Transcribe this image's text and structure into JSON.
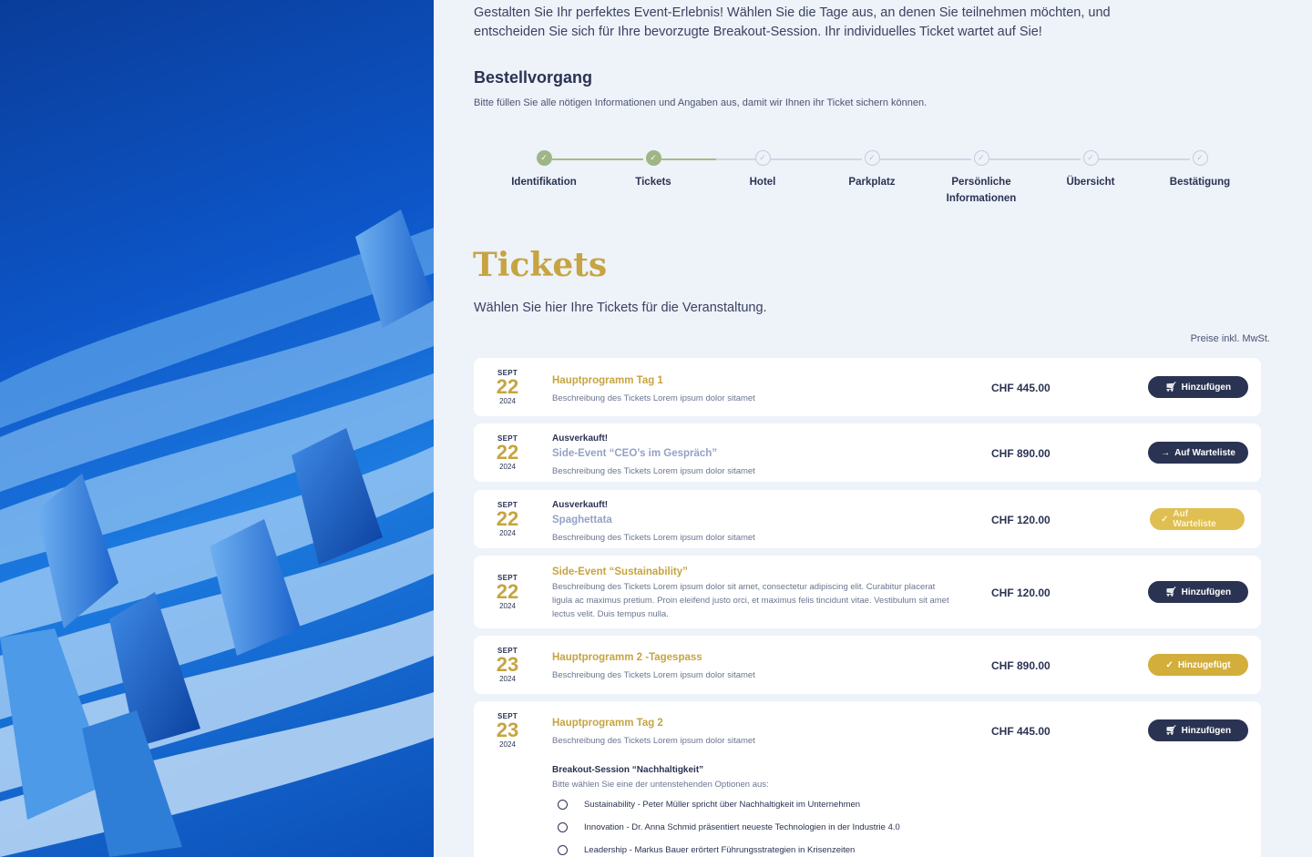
{
  "intro": "Gestalten Sie Ihr perfektes Event-Erlebnis! Wählen Sie die Tage aus, an denen Sie teilnehmen möchten, und entscheiden Sie sich für Ihre bevorzugte Breakout-Session. Ihr individuelles Ticket wartet auf Sie!",
  "order": {
    "title": "Bestellvorgang",
    "subtitle": "Bitte füllen Sie alle nötigen Informationen und Angaben aus, damit wir Ihnen ihr Ticket sichern können."
  },
  "steps": [
    {
      "label": "Identifikation",
      "done": true
    },
    {
      "label": "Tickets",
      "done": true
    },
    {
      "label": "Hotel",
      "done": false
    },
    {
      "label": "Parkplatz",
      "done": false
    },
    {
      "label": "Persönliche Informationen",
      "done": false
    },
    {
      "label": "Übersicht",
      "done": false
    },
    {
      "label": "Bestätigung",
      "done": false
    }
  ],
  "tickets_section": {
    "title": "Tickets",
    "subtitle": "Wählen Sie hier Ihre Tickets für die Veranstaltung.",
    "price_note": "Preise inkl. MwSt."
  },
  "tickets": [
    {
      "month": "SEPT",
      "day": "22",
      "year": "2024",
      "status": "",
      "name": "Hauptprogramm Tag 1",
      "desc": "Beschreibung des Tickets Lorem ipsum dolor sitamet",
      "price": "CHF 445.00",
      "button": "Hinzufügen"
    },
    {
      "month": "SEPT",
      "day": "22",
      "year": "2024",
      "status": "Ausverkauft!",
      "name": "Side-Event “CEO’s im Gespräch”",
      "desc": "Beschreibung des Tickets Lorem ipsum dolor sitamet",
      "price": "CHF 890.00",
      "button": "Auf Warteliste"
    },
    {
      "month": "SEPT",
      "day": "22",
      "year": "2024",
      "status": "Ausverkauft!",
      "name": "Spaghettata",
      "desc": "Beschreibung des Tickets Lorem ipsum dolor sitamet",
      "price": "CHF 120.00",
      "button": "Auf Warteliste"
    },
    {
      "month": "SEPT",
      "day": "22",
      "year": "2024",
      "status": "",
      "name": "Side-Event “Sustainability”",
      "desc": "Beschreibung des Tickets Lorem ipsum dolor sit amet, consectetur adipiscing elit. Curabitur placerat ligula ac maximus pretium. Proin eleifend justo orci, et maximus felis tincidunt vitae. Vestibulum sit amet lectus velit. Duis tempus nulla.",
      "price": "CHF 120.00",
      "button": "Hinzufügen"
    },
    {
      "month": "SEPT",
      "day": "23",
      "year": "2024",
      "status": "",
      "name": "Hauptprogramm 2 -Tagespass",
      "desc": "Beschreibung des Tickets Lorem ipsum dolor sitamet",
      "price": "CHF 890.00",
      "button": "Hinzugefügt"
    },
    {
      "month": "SEPT",
      "day": "23",
      "year": "2024",
      "status": "",
      "name": "Hauptprogramm Tag 2",
      "desc": "Beschreibung des Tickets Lorem ipsum dolor sitamet",
      "price": "CHF 445.00",
      "button": "Hinzufügen"
    }
  ],
  "breakout": {
    "title": "Breakout-Session “Nachhaltigkeit”",
    "subtitle": "Bitte wählen Sie eine der untenstehenden Optionen aus:",
    "options": [
      "Sustainability - Peter Müller spricht über Nachhaltigkeit im Unternehmen",
      "Innovation - Dr. Anna Schmid präsentiert neueste Technologien in der Industrie 4.0",
      "Leadership - Markus Bauer erörtert Führungsstrategien in Krisenzeiten"
    ]
  },
  "colors": {
    "accent_gold": "#c6a440",
    "navy": "#2b3352",
    "step_done": "#9fb585",
    "background": "#eef2f9"
  }
}
